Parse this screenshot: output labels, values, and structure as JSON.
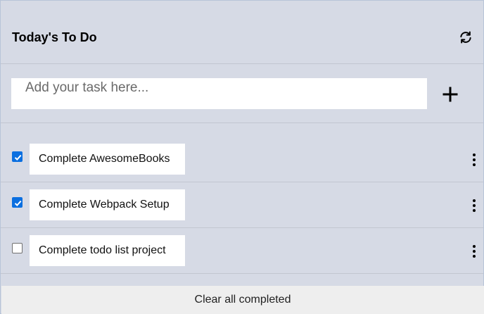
{
  "header": {
    "title": "Today's To Do",
    "refresh_icon": "refresh-icon"
  },
  "add_task": {
    "placeholder": "Add your task here...",
    "value": "",
    "add_icon": "plus-icon"
  },
  "tasks": [
    {
      "label": "Complete AwesomeBooks",
      "completed": true
    },
    {
      "label": "Complete Webpack Setup",
      "completed": true
    },
    {
      "label": "Complete todo list project",
      "completed": false
    }
  ],
  "footer": {
    "clear_label": "Clear all completed"
  },
  "colors": {
    "background": "#d6dae5",
    "checkbox_checked": "#0b6fe0",
    "clear_bar": "#eeeeee"
  }
}
